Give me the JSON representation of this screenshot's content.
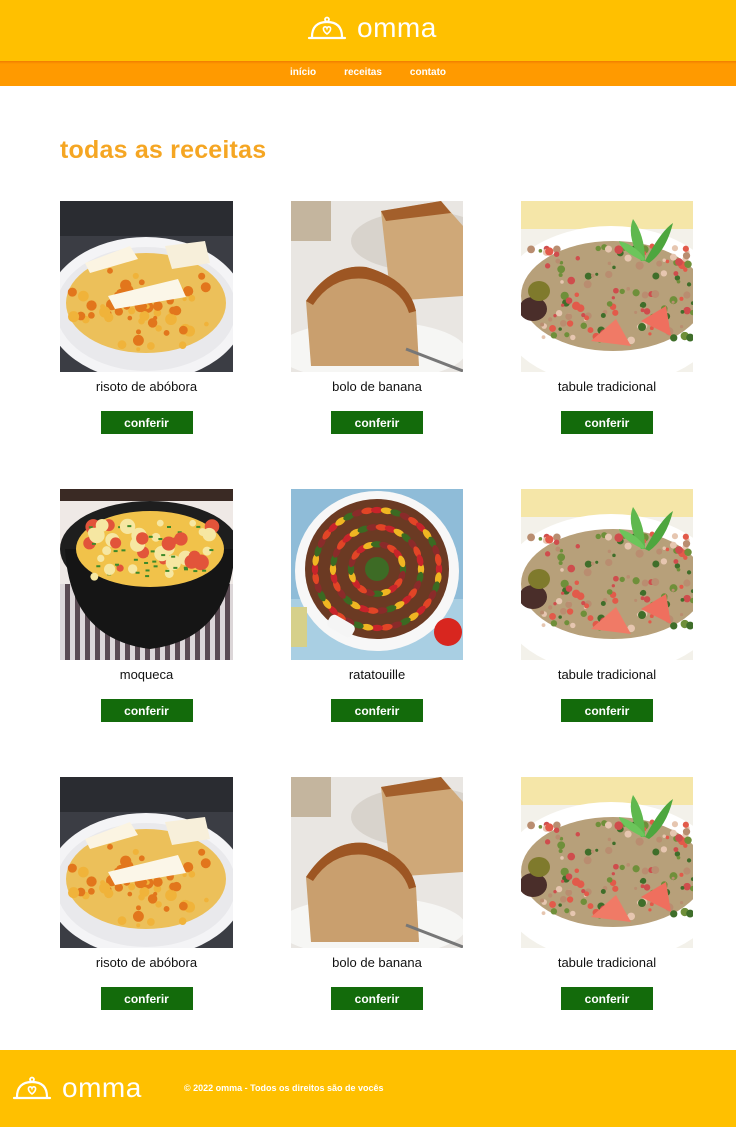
{
  "brand": {
    "name": "omma"
  },
  "nav": {
    "items": [
      "início",
      "receitas",
      "contato"
    ]
  },
  "page": {
    "title": "todas as receitas"
  },
  "recipes": [
    {
      "title": "risoto de abóbora",
      "image": "risotto"
    },
    {
      "title": "bolo de banana",
      "image": "cake"
    },
    {
      "title": "tabule tradicional",
      "image": "tabbouleh"
    },
    {
      "title": "moqueca",
      "image": "moqueca"
    },
    {
      "title": "ratatouille",
      "image": "ratatouille"
    },
    {
      "title": "tabule tradicional",
      "image": "tabbouleh"
    },
    {
      "title": "risoto de abóbora",
      "image": "risotto"
    },
    {
      "title": "bolo de banana",
      "image": "cake"
    },
    {
      "title": "tabule tradicional",
      "image": "tabbouleh"
    }
  ],
  "card": {
    "button_label": "conferir"
  },
  "footer": {
    "copyright": "© 2022 omma - Todos os direitos são de vocês"
  },
  "colors": {
    "header": "#ffc000",
    "nav": "#ff9a00",
    "title": "#f5a623",
    "button": "#136b0b"
  }
}
